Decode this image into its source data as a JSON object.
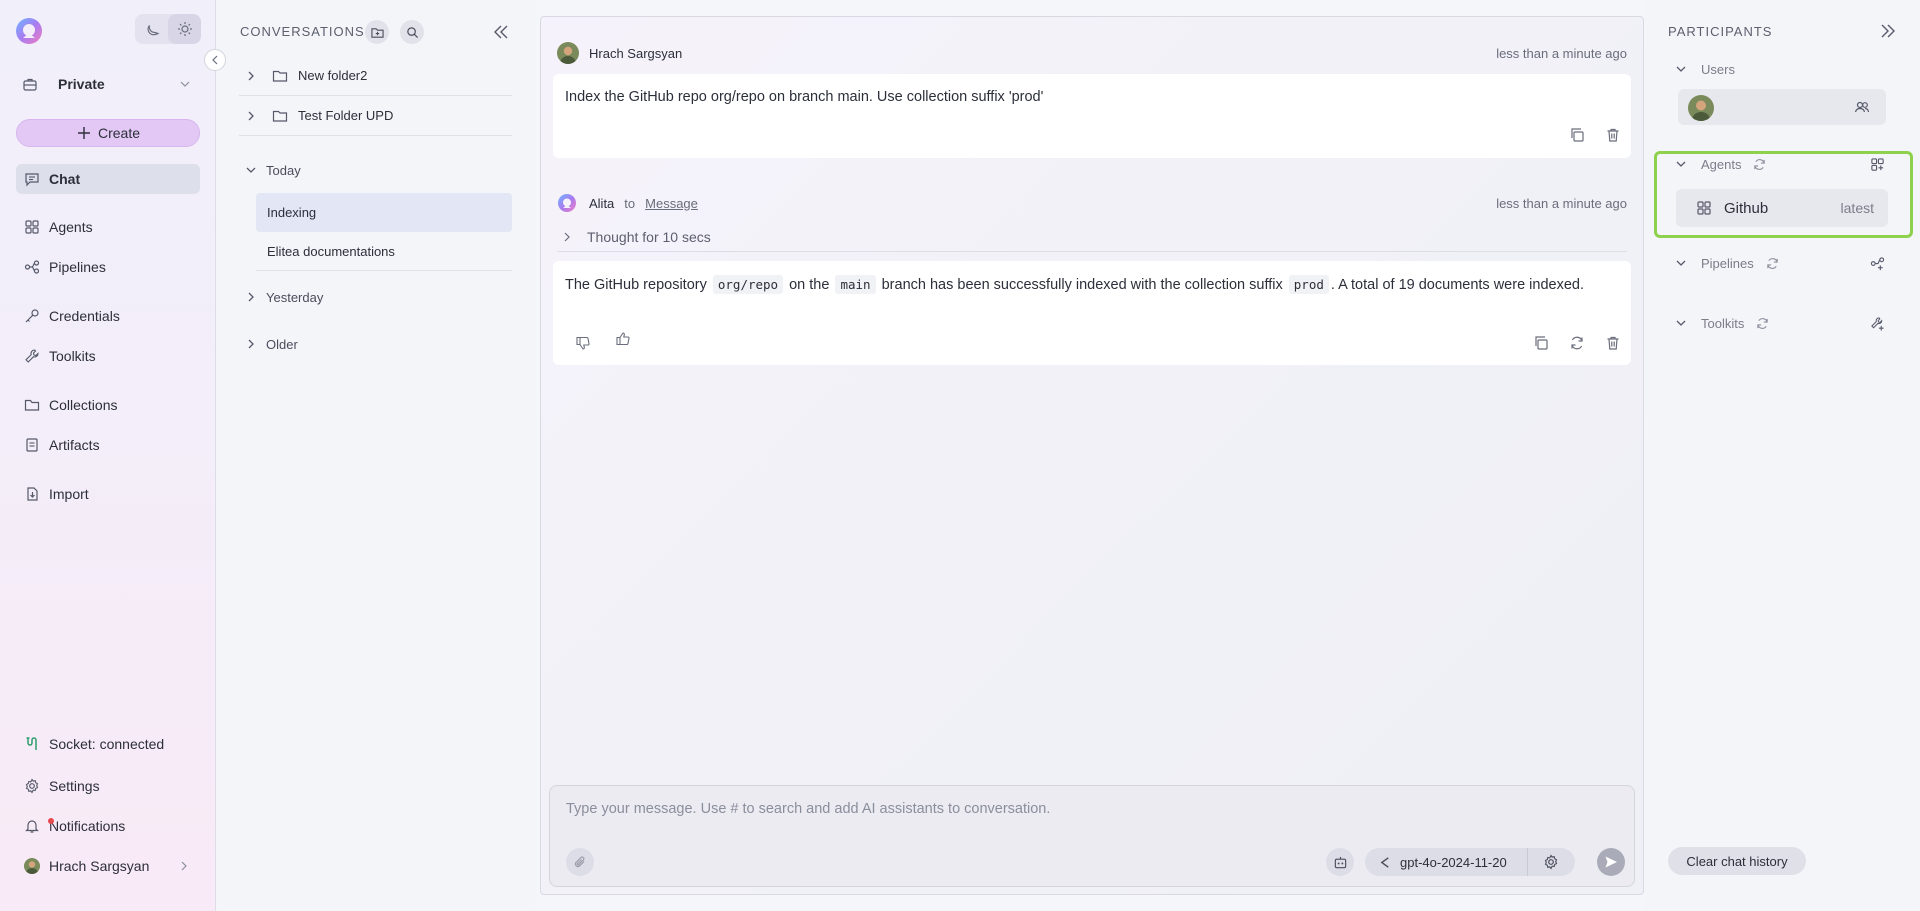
{
  "nav": {
    "project": "Private",
    "create_label": "Create",
    "items": [
      {
        "label": "Chat",
        "icon": "chat-icon"
      },
      {
        "label": "Agents",
        "icon": "agents-icon"
      },
      {
        "label": "Pipelines",
        "icon": "pipelines-icon"
      },
      {
        "label": "Credentials",
        "icon": "key-icon"
      },
      {
        "label": "Toolkits",
        "icon": "wrench-icon"
      },
      {
        "label": "Collections",
        "icon": "folder-icon"
      },
      {
        "label": "Artifacts",
        "icon": "artifact-icon"
      },
      {
        "label": "Import",
        "icon": "import-icon"
      }
    ],
    "bottom": {
      "socket": "Socket: connected",
      "settings": "Settings",
      "notifications": "Notifications",
      "user": "Hrach Sargsyan"
    }
  },
  "conversations": {
    "title": "CONVERSATIONS",
    "folders": [
      "New folder2",
      "Test Folder UPD"
    ],
    "groups": {
      "today": "Today",
      "yesterday": "Yesterday",
      "older": "Older"
    },
    "today_items": [
      "Indexing",
      "Elitea documentations"
    ]
  },
  "chat": {
    "messages": [
      {
        "author": "Hrach Sargsyan",
        "time": "less than a minute ago",
        "text": "Index the GitHub repo org/repo on branch main. Use collection suffix 'prod'"
      },
      {
        "author": "Alita",
        "to": "to",
        "target": "Message",
        "time": "less than a minute ago",
        "thought": "Thought for 10 secs",
        "parts": [
          "The GitHub repository ",
          "org/repo",
          " on the ",
          "main",
          " branch has been successfully indexed with the collection suffix ",
          "prod",
          ". A total of 19 documents were indexed."
        ]
      }
    ],
    "input_placeholder": "Type your message. Use # to search and add AI assistants to conversation.",
    "model": "gpt-4o-2024-11-20"
  },
  "participants": {
    "title": "PARTICIPANTS",
    "users_label": "Users",
    "agents_label": "Agents",
    "agent": {
      "name": "Github",
      "version": "latest"
    },
    "pipelines_label": "Pipelines",
    "toolkits_label": "Toolkits",
    "clear_label": "Clear chat history"
  },
  "colors": {
    "highlight": "#8ed14d",
    "create_button": "#e3c8f5",
    "active_conversation": "#e2e6f5"
  }
}
